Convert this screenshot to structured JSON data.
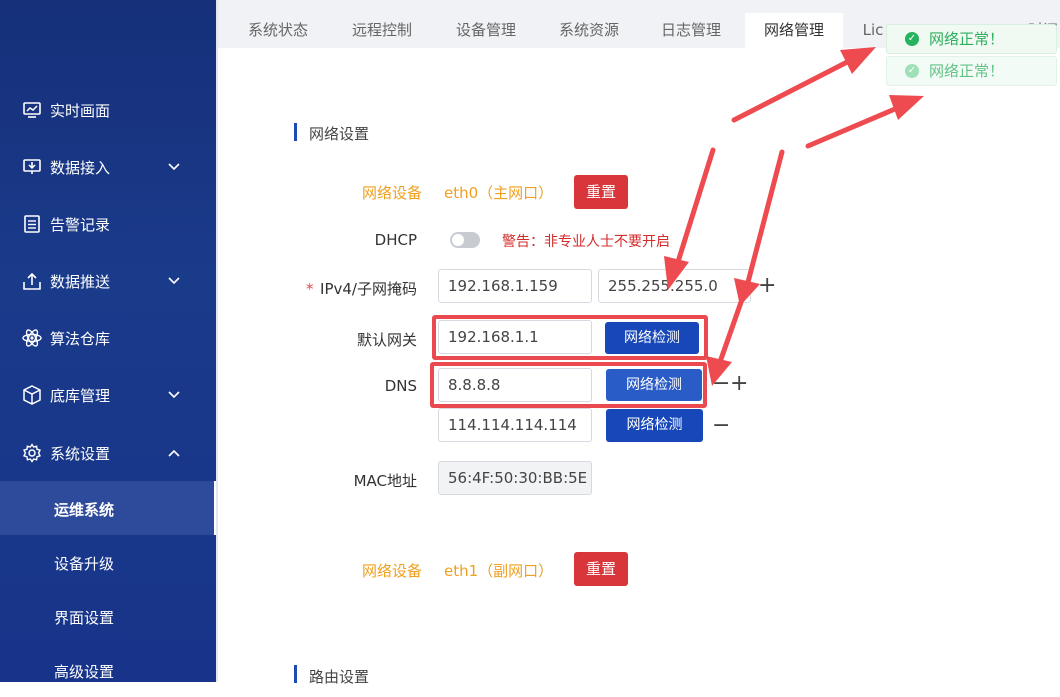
{
  "sidebar": {
    "items": [
      {
        "label": "实时画面",
        "icon": "monitor-chart-icon",
        "expandable": false
      },
      {
        "label": "数据接入",
        "icon": "download-screen-icon",
        "expandable": true
      },
      {
        "label": "告警记录",
        "icon": "document-list-icon",
        "expandable": false
      },
      {
        "label": "数据推送",
        "icon": "upload-tray-icon",
        "expandable": true
      },
      {
        "label": "算法仓库",
        "icon": "atom-icon",
        "expandable": false
      },
      {
        "label": "底库管理",
        "icon": "cube-icon",
        "expandable": true
      },
      {
        "label": "系统设置",
        "icon": "gear-icon",
        "expandable": true,
        "expanded": true
      }
    ],
    "subitems": [
      "运维系统",
      "设备升级",
      "界面设置",
      "高级设置"
    ],
    "active_subitem": "运维系统"
  },
  "tabs": [
    "系统状态",
    "远程控制",
    "设备管理",
    "系统资源",
    "日志管理",
    "网络管理",
    "Lic",
    "时间"
  ],
  "active_tab": "网络管理",
  "network": {
    "section_title": "网络设置",
    "eth0": {
      "label": "网络设备",
      "name": "eth0（主网口）",
      "reset": "重置"
    },
    "dhcp": {
      "label": "DHCP",
      "enabled": false,
      "warning": "警告：非专业人士不要开启"
    },
    "ipv4": {
      "required_mark": "*",
      "label": "IPv4/子网掩码",
      "ip": "192.168.1.159",
      "mask": "255.255.255.0",
      "add": "+"
    },
    "gateway": {
      "label": "默认网关",
      "value": "192.168.1.1",
      "check": "网络检测"
    },
    "dns": {
      "label": "DNS",
      "primary": "8.8.8.8",
      "secondary": "114.114.114.114",
      "check": "网络检测",
      "minus": "−",
      "plus": "+"
    },
    "mac": {
      "label": "MAC地址",
      "value": "56:4F:50:30:BB:5E"
    },
    "eth1": {
      "label": "网络设备",
      "name": "eth1（副网口）",
      "reset": "重置"
    },
    "route_title": "路由设置"
  },
  "toasts": [
    "网络正常！",
    "网络正常！"
  ],
  "colors": {
    "sidebar": "#1a3a8a",
    "accent": "#1747b8",
    "danger": "#d9363b",
    "warning": "#f0a020",
    "success": "#2fae5d",
    "annotation": "#ea4a4f"
  }
}
